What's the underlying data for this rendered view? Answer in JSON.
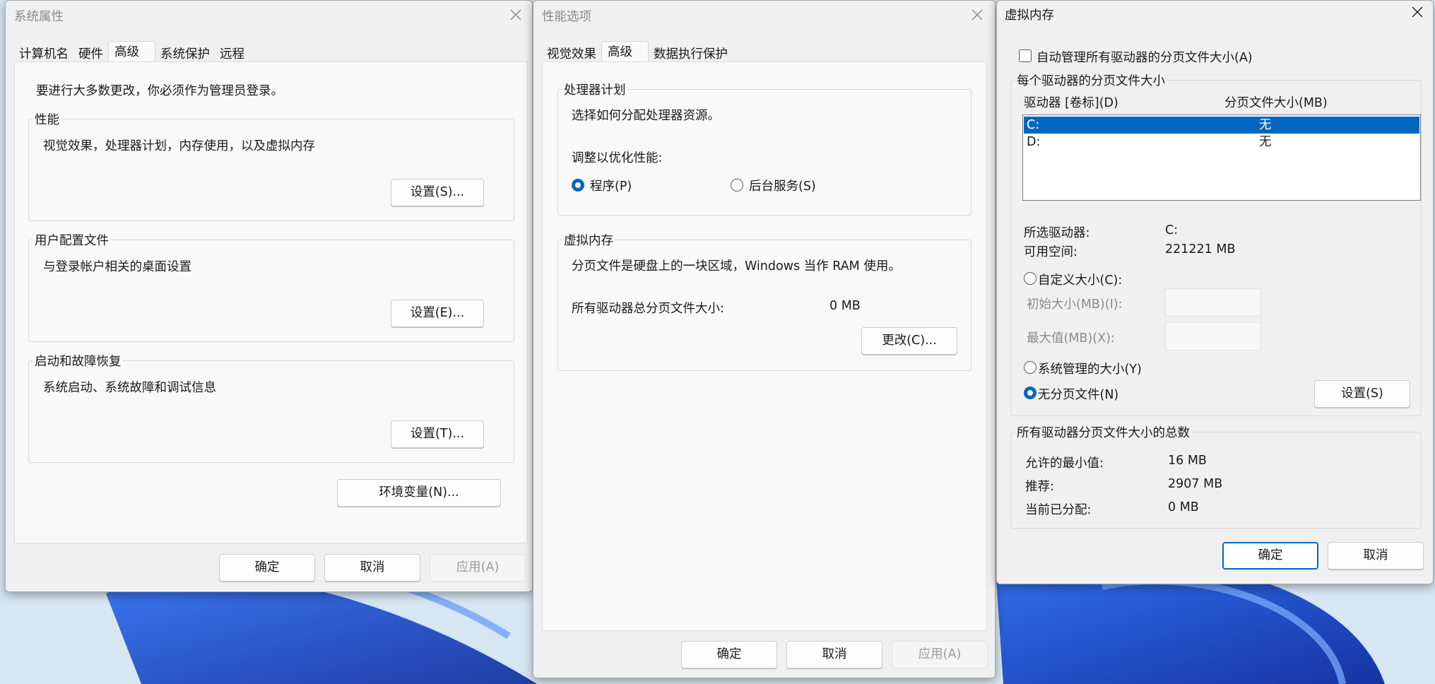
{
  "sys_props": {
    "title": "系统属性",
    "tabs": [
      "计算机名",
      "硬件",
      "高级",
      "系统保护",
      "远程"
    ],
    "admin_note": "要进行大多数更改，你必须作为管理员登录。",
    "performance": {
      "label": "性能",
      "desc": "视觉效果，处理器计划，内存使用，以及虚拟内存",
      "button": "设置(S)..."
    },
    "user_profiles": {
      "label": "用户配置文件",
      "desc": "与登录帐户相关的桌面设置",
      "button": "设置(E)..."
    },
    "startup": {
      "label": "启动和故障恢复",
      "desc": "系统启动、系统故障和调试信息",
      "button": "设置(T)..."
    },
    "env_button": "环境变量(N)...",
    "ok": "确定",
    "cancel": "取消",
    "apply": "应用(A)"
  },
  "perf_opts": {
    "title": "性能选项",
    "tabs": [
      "视觉效果",
      "高级",
      "数据执行保护"
    ],
    "scheduling": {
      "label": "处理器计划",
      "desc": "选择如何分配处理器资源。",
      "adjust": "调整以优化性能:",
      "programs": "程序(P)",
      "services": "后台服务(S)"
    },
    "virtual_memory": {
      "label": "虚拟内存",
      "desc": "分页文件是硬盘上的一块区域，Windows 当作 RAM 使用。",
      "total_label": "所有驱动器总分页文件大小:",
      "total_value": "0 MB",
      "change_button": "更改(C)..."
    },
    "ok": "确定",
    "cancel": "取消",
    "apply": "应用(A)"
  },
  "vmem": {
    "title": "虚拟内存",
    "auto_manage": "自动管理所有驱动器的分页文件大小(A)",
    "per_drive_label": "每个驱动器的分页文件大小",
    "col_drive": "驱动器 [卷标](D)",
    "col_size": "分页文件大小(MB)",
    "drives": [
      {
        "drive": "C:",
        "size": "无"
      },
      {
        "drive": "D:",
        "size": "无"
      }
    ],
    "selected_drive_label": "所选驱动器:",
    "selected_drive_value": "C:",
    "free_space_label": "可用空间:",
    "free_space_value": "221221 MB",
    "custom_size": "自定义大小(C):",
    "initial_size": "初始大小(MB)(I):",
    "max_size": "最大值(MB)(X):",
    "system_managed": "系统管理的大小(Y)",
    "no_paging": "无分页文件(N)",
    "set_button": "设置(S)",
    "totals_label": "所有驱动器分页文件大小的总数",
    "min_allowed_label": "允许的最小值:",
    "min_allowed_value": "16 MB",
    "recommended_label": "推荐:",
    "recommended_value": "2907 MB",
    "allocated_label": "当前已分配:",
    "allocated_value": "0 MB",
    "ok": "确定",
    "cancel": "取消"
  },
  "colors": {
    "accent": "#0067c0",
    "wallpaper_blue": "#1e50d8"
  }
}
